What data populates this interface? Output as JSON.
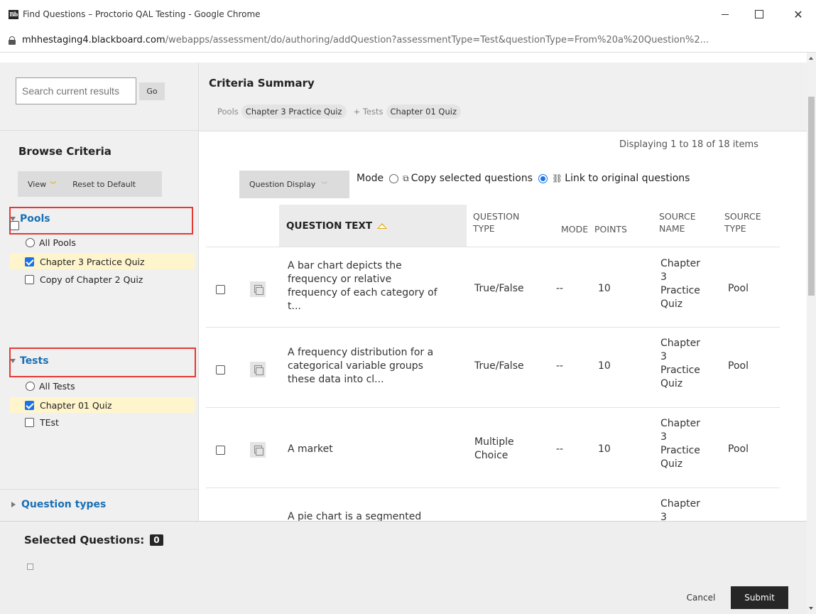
{
  "window": {
    "title": "Find Questions – Proctorio QAL Testing - Google Chrome",
    "logo_text": "Bb",
    "icon": "bb-logo",
    "controls": [
      "minimize-icon",
      "maximize-icon",
      "close-icon"
    ]
  },
  "address": {
    "host": "mhhestaging4.blackboard.com",
    "path": "/webapps/assessment/do/authoring/addQuestion?assessmentType=Test&questionType=From%20a%20Question%2..."
  },
  "search": {
    "placeholder": "Search current results",
    "go_label": "Go"
  },
  "browse": {
    "title": "Browse Criteria",
    "view_label": "View",
    "reset_label": "Reset to Default",
    "pools": {
      "heading": "Pools",
      "all_label": "All Pools",
      "items": [
        {
          "label": "Chapter 3 Practice Quiz",
          "checked": true
        },
        {
          "label": "Copy of Chapter 2 Quiz",
          "checked": false
        }
      ]
    },
    "tests": {
      "heading": "Tests",
      "all_label": "All Tests",
      "items": [
        {
          "label": "Chapter 01 Quiz",
          "checked": true
        },
        {
          "label": "TEst",
          "checked": false
        }
      ]
    },
    "question_types": {
      "heading": "Question types"
    }
  },
  "criteria": {
    "title": "Criteria Summary",
    "pools_label": "Pools",
    "pools_value": "Chapter 3 Practice Quiz",
    "tests_label": "+ Tests",
    "tests_value": "Chapter 01 Quiz"
  },
  "listing": {
    "displaying": "Displaying 1 to 18 of 18 items",
    "question_display_label": "Question Display",
    "mode_label": "Mode",
    "mode_copy": "Copy selected questions",
    "mode_link": "Link to original questions",
    "mode_selected": "link"
  },
  "table": {
    "headers": {
      "question_text": "QUESTION TEXT",
      "question_type_1": "QUESTION",
      "question_type_2": "TYPE",
      "mode": "MODE",
      "points": "POINTS",
      "source_name_1": "SOURCE",
      "source_name_2": "NAME",
      "source_type_1": "SOURCE",
      "source_type_2": "TYPE"
    },
    "rows": [
      {
        "text": [
          "A bar chart depicts the",
          "frequency or relative",
          "frequency of each category of",
          "t..."
        ],
        "type": [
          "True/False"
        ],
        "mode": "--",
        "points": "10",
        "source_name": [
          "Chapter",
          "3",
          "Practice",
          "Quiz"
        ],
        "source_type": "Pool"
      },
      {
        "text": [
          "A frequency distribution for a",
          "categorical variable groups",
          "these data into cl..."
        ],
        "type": [
          "True/False"
        ],
        "mode": "--",
        "points": "10",
        "source_name": [
          "Chapter",
          "3",
          "Practice",
          "Quiz"
        ],
        "source_type": "Pool"
      },
      {
        "text": [
          "A market"
        ],
        "type": [
          "Multiple",
          "Choice"
        ],
        "mode": "--",
        "points": "10",
        "source_name": [
          "Chapter",
          "3",
          "Practice",
          "Quiz"
        ],
        "source_type": "Pool"
      },
      {
        "text": [
          "A pie chart is a segmented"
        ],
        "type": [],
        "mode": "",
        "points": "",
        "source_name": [
          "Chapter",
          "3"
        ],
        "source_type": ""
      }
    ]
  },
  "selected": {
    "title": "Selected Questions:",
    "count": "0",
    "cancel_label": "Cancel",
    "submit_label": "Submit"
  }
}
